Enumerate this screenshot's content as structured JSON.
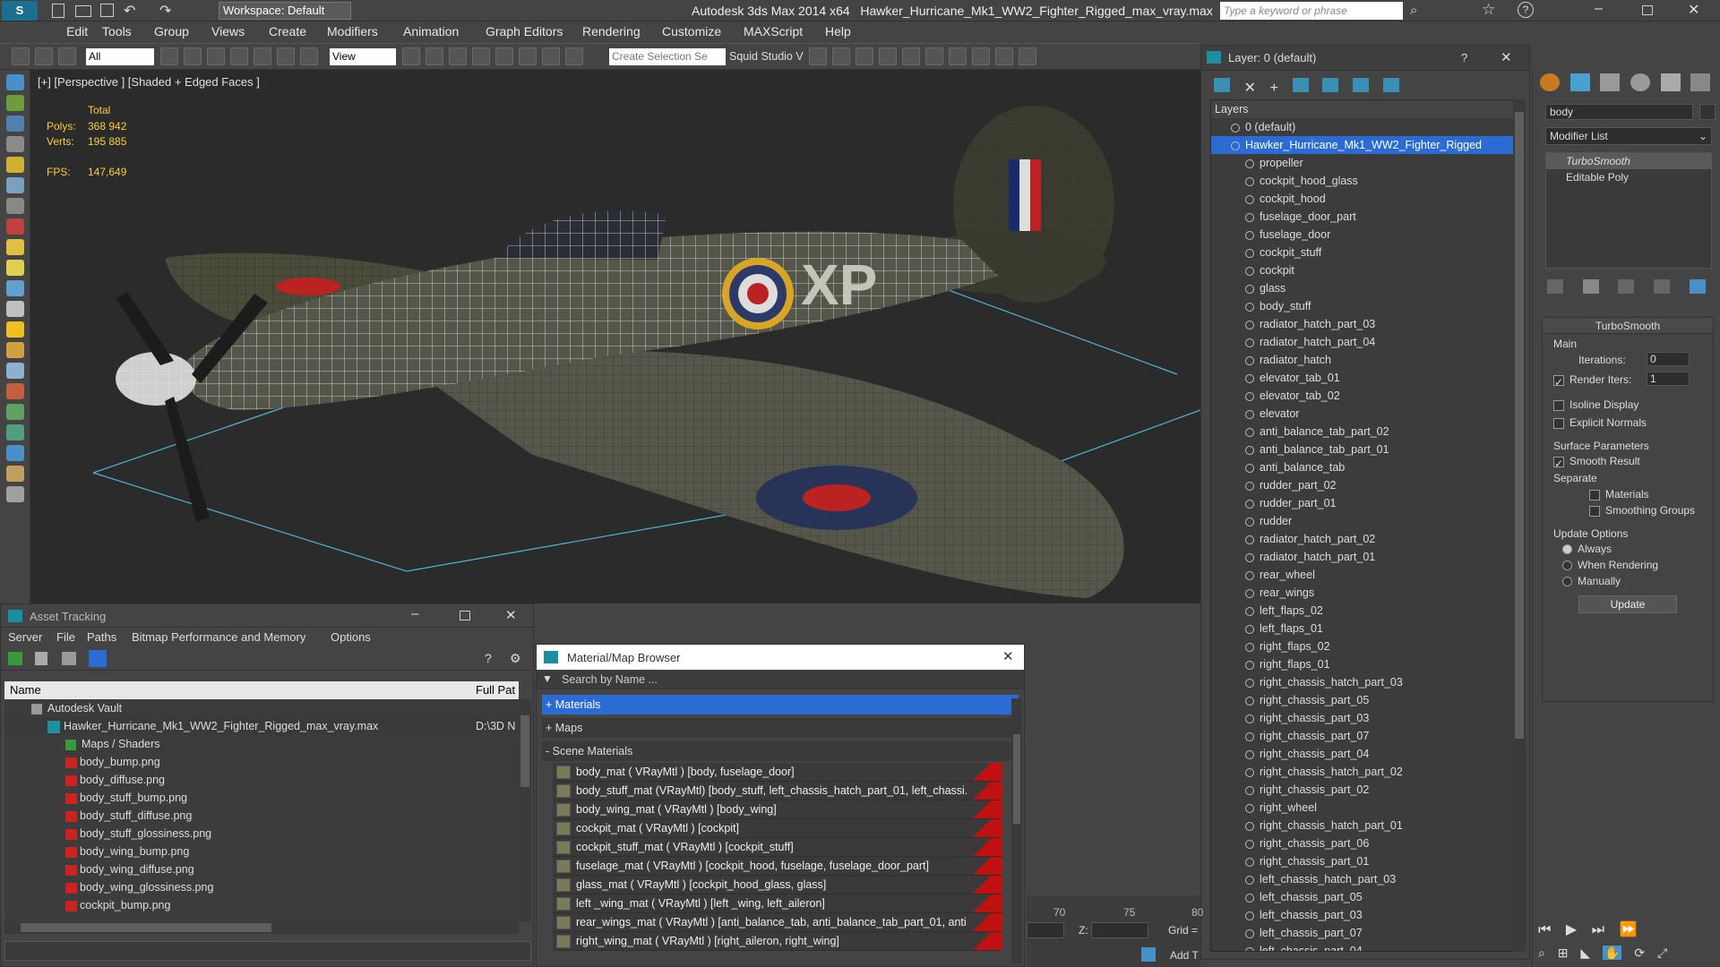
{
  "app": {
    "title": "Autodesk 3ds Max  2014 x64",
    "file": "Hawker_Hurricane_Mk1_WW2_Fighter_Rigged_max_vray.max",
    "workspace": "Workspace: Default",
    "search_placeholder": "Type a keyword or phrase"
  },
  "menu": [
    "Edit",
    "Tools",
    "Group",
    "Views",
    "Create",
    "Modifiers",
    "Animation",
    "Graph Editors",
    "Rendering",
    "Customize",
    "MAXScript",
    "Help"
  ],
  "toolbar": {
    "filter": "All",
    "view": "View",
    "selection_set": "Create Selection Se",
    "studio": "Squid Studio V"
  },
  "viewport": {
    "label": "[+] [Perspective ] [Shaded + Edged Faces ]",
    "total_label": "Total",
    "polys_label": "Polys:",
    "polys": "368 942",
    "verts_label": "Verts:",
    "verts": "195 885",
    "fps_label": "FPS:",
    "fps": "147,649",
    "markings": "XP"
  },
  "layer_panel": {
    "title": "Layer: 0 (default)",
    "help": "?",
    "header": "Layers",
    "items": [
      "0 (default)",
      "Hawker_Hurricane_Mk1_WW2_Fighter_Rigged",
      "propeller",
      "cockpit_hood_glass",
      "cockpit_hood",
      "fuselage_door_part",
      "fuselage_door",
      "cockpit_stuff",
      "cockpit",
      "glass",
      "body_stuff",
      "radiator_hatch_part_03",
      "radiator_hatch_part_04",
      "radiator_hatch",
      "elevator_tab_01",
      "elevator_tab_02",
      "elevator",
      "anti_balance_tab_part_02",
      "anti_balance_tab_part_01",
      "anti_balance_tab",
      "rudder_part_02",
      "rudder_part_01",
      "rudder",
      "radiator_hatch_part_02",
      "radiator_hatch_part_01",
      "rear_wheel",
      "rear_wings",
      "left_flaps_02",
      "left_flaps_01",
      "right_flaps_02",
      "right_flaps_01",
      "right_chassis_hatch_part_03",
      "right_chassis_part_05",
      "right_chassis_part_03",
      "right_chassis_part_07",
      "right_chassis_part_04",
      "right_chassis_hatch_part_02",
      "right_chassis_part_02",
      "right_wheel",
      "right_chassis_hatch_part_01",
      "right_chassis_part_06",
      "right_chassis_part_01",
      "left_chassis_hatch_part_03",
      "left_chassis_part_05",
      "left_chassis_part_03",
      "left_chassis_part_07",
      "left_chassis_part_04"
    ]
  },
  "command_panel": {
    "object_name": "body",
    "modifier_list": "Modifier List",
    "stack": [
      "TurboSmooth",
      "Editable Poly"
    ],
    "rollout": "TurboSmooth",
    "main": "Main",
    "iterations_label": "Iterations:",
    "iterations": "0",
    "render_iters_label": "Render Iters:",
    "render_iters": "1",
    "isoline": "Isoline Display",
    "explicit": "Explicit Normals",
    "surface": "Surface Parameters",
    "smooth_result": "Smooth Result",
    "separate": "Separate",
    "materials": "Materials",
    "smoothing": "Smoothing Groups",
    "update_options": "Update Options",
    "always": "Always",
    "when_rendering": "When Rendering",
    "manually": "Manually",
    "update_btn": "Update"
  },
  "asset": {
    "title": "Asset Tracking",
    "menu": [
      "Server",
      "File",
      "Paths",
      "Bitmap Performance and Memory",
      "Options"
    ],
    "col_name": "Name",
    "col_path": "Full Pat",
    "vault": "Autodesk Vault",
    "file": "Hawker_Hurricane_Mk1_WW2_Fighter_Rigged_max_vray.max",
    "file_path": "D:\\3D N",
    "maps": "Maps / Shaders",
    "textures": [
      "body_bump.png",
      "body_diffuse.png",
      "body_stuff_bump.png",
      "body_stuff_diffuse.png",
      "body_stuff_glossiness.png",
      "body_wing_bump.png",
      "body_wing_diffuse.png",
      "body_wing_glossiness.png",
      "cockpit_bump.png"
    ]
  },
  "matbrowser": {
    "title": "Material/Map Browser",
    "search": "Search by Name ...",
    "materials": "+ Materials",
    "maps": "+ Maps",
    "scene": "- Scene Materials",
    "items": [
      "body_mat  ( VRayMtl ) [body, fuselage_door]",
      "body_stuff_mat  (VRayMtl) [body_stuff, left_chassis_hatch_part_01, left_chassi...",
      "body_wing_mat  ( VRayMtl ) [body_wing]",
      "cockpit_mat  ( VRayMtl ) [cockpit]",
      "cockpit_stuff_mat  ( VRayMtl ) [cockpit_stuff]",
      "fuselage_mat  ( VRayMtl ) [cockpit_hood, fuselage, fuselage_door_part]",
      "glass_mat  ( VRayMtl ) [cockpit_hood_glass, glass]",
      "left _wing_mat  ( VRayMtl ) [left _wing, left_aileron]",
      "rear_wings_mat  ( VRayMtl ) [anti_balance_tab, anti_balance_tab_part_01, anti...",
      "right_wing_mat  ( VRayMtl ) [right_aileron, right_wing]"
    ]
  },
  "timeline": {
    "t70": "70",
    "t75": "75",
    "t80": "80",
    "z": "Z:",
    "grid": "Grid =",
    "addt": "Add T"
  }
}
